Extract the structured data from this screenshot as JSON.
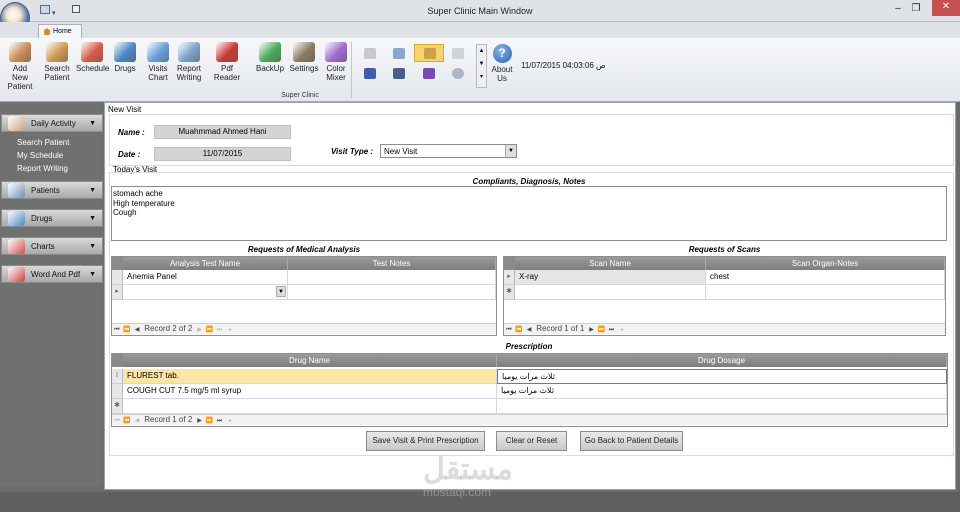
{
  "window": {
    "title": "Super Clinic Main Window",
    "tab": "Home"
  },
  "ribbon": {
    "buttons": [
      {
        "label": "Add New\nPatient",
        "icon": "doctor-add-icon",
        "color": "#c98d58"
      },
      {
        "label": "Search\nPatient",
        "icon": "patients-search-icon",
        "color": "#d09a4e"
      },
      {
        "label": "Schedule",
        "icon": "calendar-icon",
        "color": "#d75a4a"
      },
      {
        "label": "Drugs",
        "icon": "syringe-icon",
        "color": "#4b86c4"
      },
      {
        "label": "Visits\nChart",
        "icon": "bar-chart-icon",
        "color": "#6a9fd6"
      },
      {
        "label": "Report\nWriting",
        "icon": "report-icon",
        "color": "#7ea3c9"
      },
      {
        "label": "Pdf Reader",
        "icon": "pdf-icon",
        "color": "#c93a32"
      },
      {
        "label": "BackUp",
        "icon": "backup-icon",
        "color": "#4ca95a"
      },
      {
        "label": "Settings",
        "icon": "settings-icon",
        "color": "#8a7a62"
      },
      {
        "label": "Color\nMixer",
        "icon": "color-wheel-icon",
        "color": "#9f6bd0"
      }
    ],
    "group_label": "Super Clinic",
    "about_label": "About\nUs",
    "datetime": "11/07/2015 04:03:06 ص"
  },
  "sidebar": {
    "groups": [
      {
        "label": "Daily Activity",
        "icon": "doctor-icon",
        "items": [
          "Search Patient",
          "My Schedule",
          "Report Writing"
        ]
      },
      {
        "label": "Patients",
        "icon": "patient-icon",
        "items": []
      },
      {
        "label": "Drugs",
        "icon": "syringe-icon",
        "items": []
      },
      {
        "label": "Charts",
        "icon": "chart-icon",
        "items": []
      },
      {
        "label": "Word And Pdf",
        "icon": "word-pdf-icon",
        "items": []
      }
    ]
  },
  "form": {
    "panel_title": "New Visit",
    "name_label": "Name :",
    "name_value": "Muahmmad Ahmed Hani",
    "date_label": "Date :",
    "date_value": "11/07/2015",
    "visit_type_label": "Visit Type :",
    "visit_type_value": "New Visit",
    "todays_visit": "Today's Visit",
    "notes_title": "Compliants, Diagnosis, Notes",
    "notes_lines": [
      "stomach ache",
      "High temperature",
      "Cough"
    ],
    "analysis_title": "Requests of Medical Analysis",
    "analysis_cols": [
      "Analysis Test Name",
      "Test Notes"
    ],
    "analysis_rows": [
      [
        "Anemia Panel",
        ""
      ]
    ],
    "analysis_record": "Record 2 of 2",
    "scans_title": "Requests of Scans",
    "scans_cols": [
      "Scan Name",
      "Scan Organ-Notes"
    ],
    "scans_rows": [
      [
        "X-ray",
        "chest"
      ]
    ],
    "scans_record": "Record 1 of 1",
    "prescription_title": "Prescription",
    "rx_cols": [
      "Drug Name",
      "Drug Dosage"
    ],
    "rx_rows": [
      [
        "FLUREST tab.",
        "ثلاث مرات يوميا"
      ],
      [
        "COUGH CUT 7.5 mg/5 ml syrup",
        "ثلاث مرات يوميا"
      ]
    ],
    "rx_record": "Record 1 of 2",
    "btn_save": "Save Visit & Print Prescription",
    "btn_clear": "Clear or Reset",
    "btn_back": "Go Back to Patient Details"
  },
  "watermark": {
    "text": "مستقل",
    "sub": "mostaql.com"
  }
}
